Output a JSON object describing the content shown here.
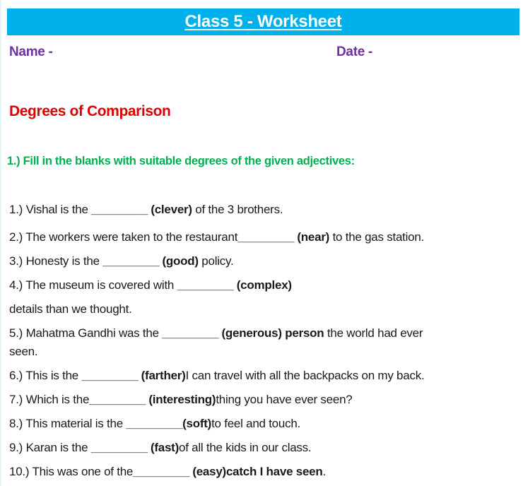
{
  "header": {
    "title": "Class 5 - Worksheet",
    "banner_color": "#00b0eb"
  },
  "meta": {
    "name_label": "Name -",
    "date_label": "Date -",
    "label_color": "#7030a0"
  },
  "section": {
    "title": "Degrees of Comparison",
    "title_color": "#e00000",
    "instruction": "1.) Fill in the blanks with suitable degrees of the given adjectives:",
    "instruction_color": "#00b050"
  },
  "questions": [
    {
      "number": "1.)",
      "before": " Vishal is the ",
      "blank": "_________",
      "hint": " (clever)",
      "after": " of the 3 brothers.",
      "continuation": ""
    },
    {
      "number": "2.)",
      "before": " The workers were taken to the restaurant",
      "blank": "_________",
      "hint": " (near)",
      "after": " to the gas station.",
      "continuation": ""
    },
    {
      "number": "3.)",
      "before": " Honesty is the ",
      "blank": "_________",
      "hint": " (good)",
      "after": " policy.",
      "continuation": ""
    },
    {
      "number": "4.)",
      "before": " The museum is covered with ",
      "blank": "_________",
      "hint": " (complex)",
      "after": "",
      "continuation": "details than we thought."
    },
    {
      "number": "5.)",
      "before": " Mahatma Gandhi was the ",
      "blank": "_________",
      "hint": " (generous) person",
      "after": " the world had ever",
      "continuation": "seen."
    },
    {
      "number": "6.)",
      "before": " This is the ",
      "blank": "_________",
      "hint": " (farther)",
      "after": "I can travel with all the backpacks on my back.",
      "continuation": ""
    },
    {
      "number": "7.)",
      "before": " Which is the",
      "blank": "_________",
      "hint": " (interesting)",
      "after": "thing you have ever seen?",
      "continuation": ""
    },
    {
      "number": "8.)",
      "before": " This material is the ",
      "blank": "_________",
      "hint": "(soft)",
      "after": "to feel and touch.",
      "continuation": ""
    },
    {
      "number": "9.)",
      "before": " Karan is the ",
      "blank": "_________",
      "hint": " (fast)",
      "after": "of all the kids in our class.",
      "continuation": ""
    },
    {
      "number": "10.)",
      "before": " This was one of the",
      "blank": "_________",
      "hint": " (easy)catch I have seen",
      "after": ".",
      "continuation": ""
    }
  ]
}
